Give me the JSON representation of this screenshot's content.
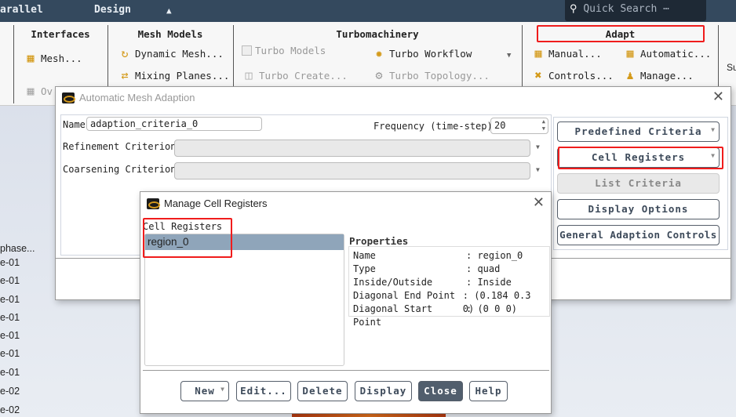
{
  "topbar": {
    "tab_parallel": "arallel",
    "tab_design": "Design",
    "collapse": "▲",
    "search_placeholder": "Quick Search",
    "search_more": "⋯"
  },
  "ribbon": {
    "interfaces": {
      "title": "Interfaces",
      "mesh": "Mesh...",
      "overset": "Ov"
    },
    "mesh_models": {
      "title": "Mesh Models",
      "dynamic": "Dynamic Mesh...",
      "mixing": "Mixing Planes..."
    },
    "turbo": {
      "title": "Turbomachinery",
      "models": "Turbo Models",
      "create": "Turbo Create...",
      "workflow": "Turbo Workflow",
      "topology": "Turbo Topology..."
    },
    "adapt": {
      "title": "Adapt",
      "manual": "Manual...",
      "automatic": "Automatic...",
      "controls": "Controls...",
      "manage": "Manage..."
    },
    "partial_right": "Su"
  },
  "background_list": [
    "phase...",
    "e-01",
    "e-01",
    "e-01",
    "e-01",
    "e-01",
    "e-01",
    "e-01",
    "e-02",
    "e-02"
  ],
  "auto_dialog": {
    "title": "Automatic Mesh Adaption",
    "name_label": "Name",
    "name_value": "adaption_criteria_0",
    "frequency_label": "Frequency (time-step)",
    "frequency_value": "20",
    "refinement_label": "Refinement Criterion",
    "coarsening_label": "Coarsening Criterion",
    "buttons": {
      "predefined": "Predefined Criteria",
      "cell_registers": "Cell Registers",
      "list_criteria": "List Criteria",
      "display_options": "Display Options",
      "general": "General Adaption Controls"
    }
  },
  "manage_dialog": {
    "title": "Manage Cell Registers",
    "list_label": "Cell Registers",
    "items": [
      "region_0"
    ],
    "properties_label": "Properties",
    "properties": [
      {
        "k": "Name",
        "v": ": region_0"
      },
      {
        "k": "Type",
        "v": ": quad"
      },
      {
        "k": "Inside/Outside",
        "v": ": Inside"
      },
      {
        "k": "Diagonal End Point",
        "v": ": (0.184 0.3 0)"
      },
      {
        "k": "Diagonal Start Point",
        "v": ": (0 0 0)"
      }
    ],
    "buttons": {
      "new": "New",
      "edit": "Edit...",
      "delete": "Delete",
      "display": "Display",
      "close": "Close",
      "help": "Help"
    }
  }
}
